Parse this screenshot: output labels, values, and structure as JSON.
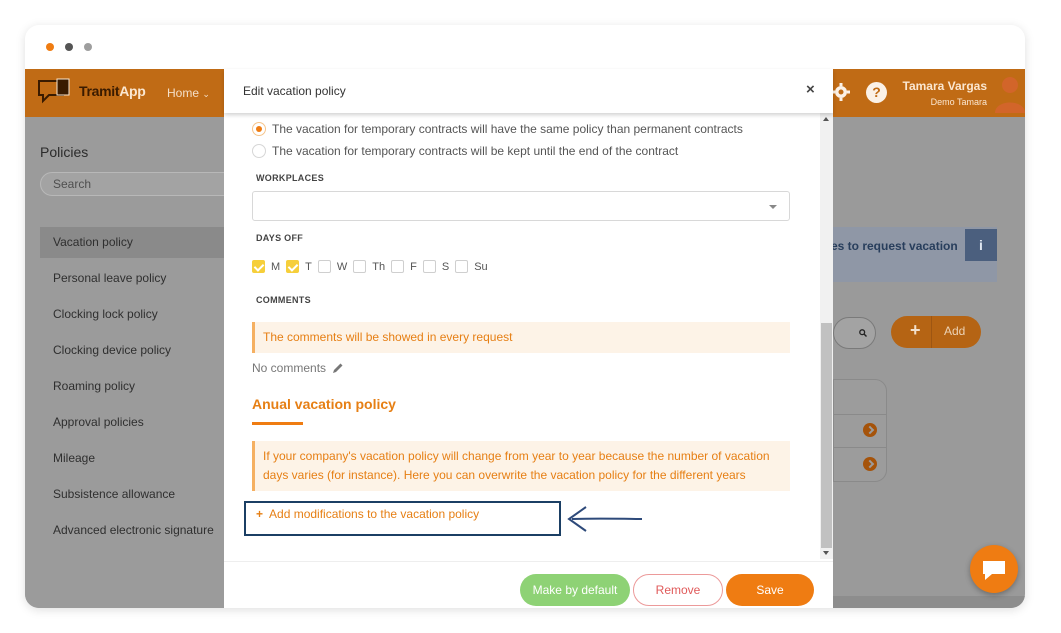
{
  "window": {
    "dots": [
      "#ef7c12",
      "#555555",
      "#9e9e9e"
    ]
  },
  "topbar": {
    "logo_text_1": "Tramit",
    "logo_text_2": "App",
    "home_label": "Home",
    "user_name": "Tamara Vargas",
    "user_company": "Demo Tamara"
  },
  "sidebar": {
    "title": "Policies",
    "search_placeholder": "Search",
    "items": [
      {
        "label": "Vacation policy",
        "active": true
      },
      {
        "label": "Personal leave policy"
      },
      {
        "label": "Clocking lock policy"
      },
      {
        "label": "Clocking device policy"
      },
      {
        "label": "Roaming policy"
      },
      {
        "label": "Approval policies"
      },
      {
        "label": "Mileage"
      },
      {
        "label": "Subsistence allowance"
      },
      {
        "label": "Advanced electronic signature"
      }
    ]
  },
  "background": {
    "banner_text": "es to request vacation",
    "info_label": "i",
    "add_label": "Add"
  },
  "modal": {
    "title": "Edit vacation policy",
    "close": "×",
    "radio_1": "The vacation for temporary contracts will have the same policy than permanent contracts",
    "radio_2": "The vacation for temporary contracts will be kept until the end of the contract",
    "workplaces_label": "WORKPLACES",
    "days_off_label": "DAYS OFF",
    "days": [
      {
        "label": "M",
        "checked": true
      },
      {
        "label": "T",
        "checked": true
      },
      {
        "label": "W",
        "checked": false
      },
      {
        "label": "Th",
        "checked": false
      },
      {
        "label": "F",
        "checked": false
      },
      {
        "label": "S",
        "checked": false
      },
      {
        "label": "Su",
        "checked": false
      }
    ],
    "comments_label": "COMMENTS",
    "comments_note": "The comments will be showed in every request",
    "no_comments": "No comments",
    "anual_title": "Anual vacation policy",
    "anual_note": "If your company's vacation policy will change from year to year because the number of vacation days varies (for instance). Here you can overwrite the vacation policy for the different years",
    "add_modifications": "Add modifications to the vacation policy",
    "btn_default": "Make by default",
    "btn_remove": "Remove",
    "btn_save": "Save"
  },
  "colors": {
    "brand_orange": "#ef7c12",
    "topbar_dimmed": "#c06b15",
    "success_green": "#8ed275",
    "annotation_blue": "#1b3f64"
  }
}
